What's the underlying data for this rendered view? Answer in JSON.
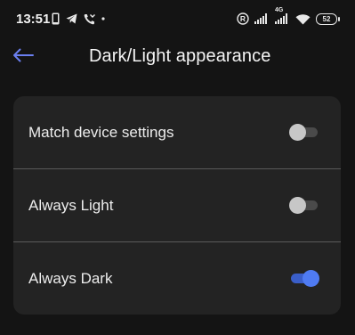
{
  "status_bar": {
    "time": "13:51",
    "left_icons": [
      "phone-icon",
      "telegram-icon",
      "missed-call-icon",
      "dot-icon"
    ],
    "right_icons": [
      "registered-icon",
      "signal-icon",
      "signal-4g-icon",
      "wifi-icon"
    ],
    "network_label": "4G",
    "battery_level": "52"
  },
  "header": {
    "title": "Dark/Light appearance",
    "back_icon": "arrow-left-icon",
    "accent_color": "#6b7ff0"
  },
  "settings": {
    "options": [
      {
        "label": "Match device settings",
        "enabled": false
      },
      {
        "label": "Always Light",
        "enabled": false
      },
      {
        "label": "Always Dark",
        "enabled": true
      }
    ]
  },
  "colors": {
    "background": "#141414",
    "card": "#232323",
    "toggle_on": "#4f7bf2",
    "toggle_off": "#c7c7c7"
  }
}
